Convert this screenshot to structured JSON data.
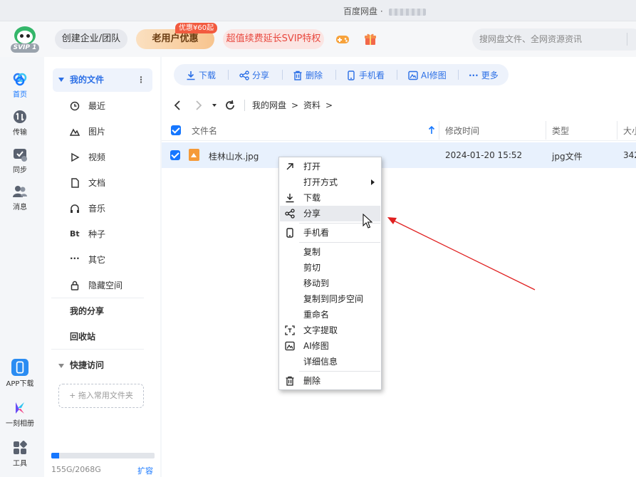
{
  "window": {
    "title": "百度网盘 ·"
  },
  "header": {
    "logo_badge": "SVIP 1",
    "enterprise_label": "创建企业/团队",
    "olduser_label": "老用户优惠",
    "promo_tag": "优惠¥60起",
    "svip_label": "超值续费延长SVIP特权",
    "search_placeholder": "搜网盘文件、全网资源资讯"
  },
  "rail": {
    "items": [
      {
        "label": "首页",
        "icon": "home-icon"
      },
      {
        "label": "传输",
        "icon": "transfer-icon"
      },
      {
        "label": "同步",
        "icon": "sync-icon"
      },
      {
        "label": "消息",
        "icon": "message-icon"
      },
      {
        "label": "APP下载",
        "icon": "app-download-icon"
      },
      {
        "label": "一刻相册",
        "icon": "album-icon"
      },
      {
        "label": "工具",
        "icon": "tools-icon"
      }
    ]
  },
  "nav": {
    "my_files": "我的文件",
    "more": "⋮",
    "items": [
      {
        "label": "最近",
        "icon": "clock-icon"
      },
      {
        "label": "图片",
        "icon": "image-icon"
      },
      {
        "label": "视频",
        "icon": "video-icon"
      },
      {
        "label": "文档",
        "icon": "document-icon"
      },
      {
        "label": "音乐",
        "icon": "headphone-icon"
      },
      {
        "label": "种子",
        "icon": "bt-icon"
      },
      {
        "label": "其它",
        "icon": "more-icon"
      },
      {
        "label": "隐藏空间",
        "icon": "lock-icon"
      }
    ],
    "bt_text": "Bt",
    "more_dots": "···",
    "my_share": "我的分享",
    "recycle": "回收站",
    "quick_access": "快捷访问",
    "drag_hint": "+ 拖入常用文件夹",
    "storage_text": "155G/2068G",
    "storage_fraction": 0.075,
    "expand": "扩容"
  },
  "toolbar": {
    "download": "下载",
    "share": "分享",
    "delete": "删除",
    "phone_view": "手机看",
    "ai_image": "AI修图",
    "more": "更多"
  },
  "breadcrumb": {
    "root": "我的网盘",
    "sep1": ">",
    "folder": "资料",
    "sep2": ">"
  },
  "table": {
    "col_name": "文件名",
    "col_mtime": "修改时间",
    "col_type": "类型",
    "col_size": "大小",
    "rows": [
      {
        "name": "桂林山水.jpg",
        "mtime": "2024-01-20 15:52",
        "type": "jpg文件",
        "size": "342"
      }
    ]
  },
  "context_menu": {
    "open": "打开",
    "open_with": "打开方式",
    "download": "下载",
    "share": "分享",
    "phone_view": "手机看",
    "copy": "复制",
    "cut": "剪切",
    "move_to": "移动到",
    "copy_to_sync": "复制到同步空间",
    "rename": "重命名",
    "extract_text": "文字提取",
    "ai_image": "AI修图",
    "details": "详细信息",
    "delete": "删除"
  },
  "colors": {
    "accent": "#1677ff",
    "svip_red": "#e8483e",
    "annotation_arrow": "#e02020"
  }
}
